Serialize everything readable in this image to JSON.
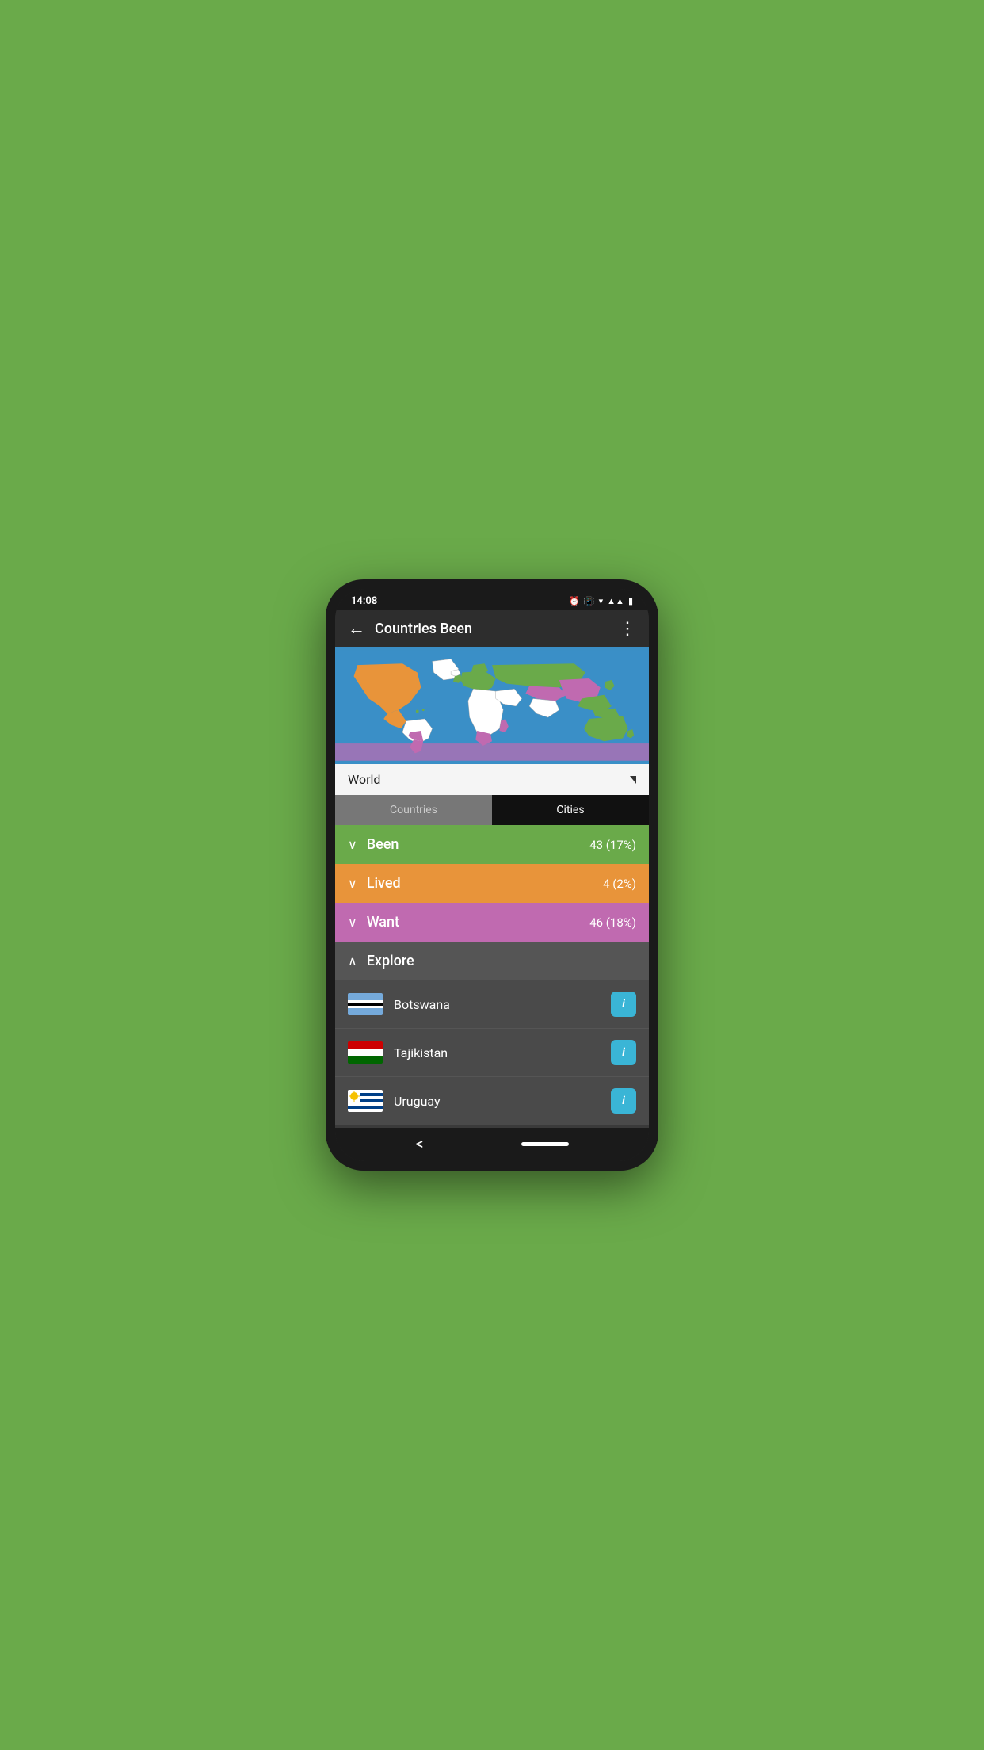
{
  "statusBar": {
    "time": "14:08"
  },
  "appBar": {
    "title": "Countries Been",
    "backLabel": "←",
    "menuLabel": "⋮"
  },
  "worldSelector": {
    "label": "World"
  },
  "tabs": {
    "countries": "Countries",
    "cities": "Cities"
  },
  "sections": {
    "been": {
      "label": "Been",
      "count": "43 (17%)",
      "chevron": "∨"
    },
    "lived": {
      "label": "Lived",
      "count": "4 (2%)",
      "chevron": "∨"
    },
    "want": {
      "label": "Want",
      "count": "46 (18%)",
      "chevron": "∨"
    },
    "explore": {
      "label": "Explore",
      "chevron": "∧"
    }
  },
  "countries": [
    {
      "name": "Botswana",
      "flag": "botswana"
    },
    {
      "name": "Tajikistan",
      "flag": "tajikistan"
    },
    {
      "name": "Uruguay",
      "flag": "uruguay"
    }
  ],
  "infoButton": "i",
  "navBar": {
    "back": "<"
  }
}
